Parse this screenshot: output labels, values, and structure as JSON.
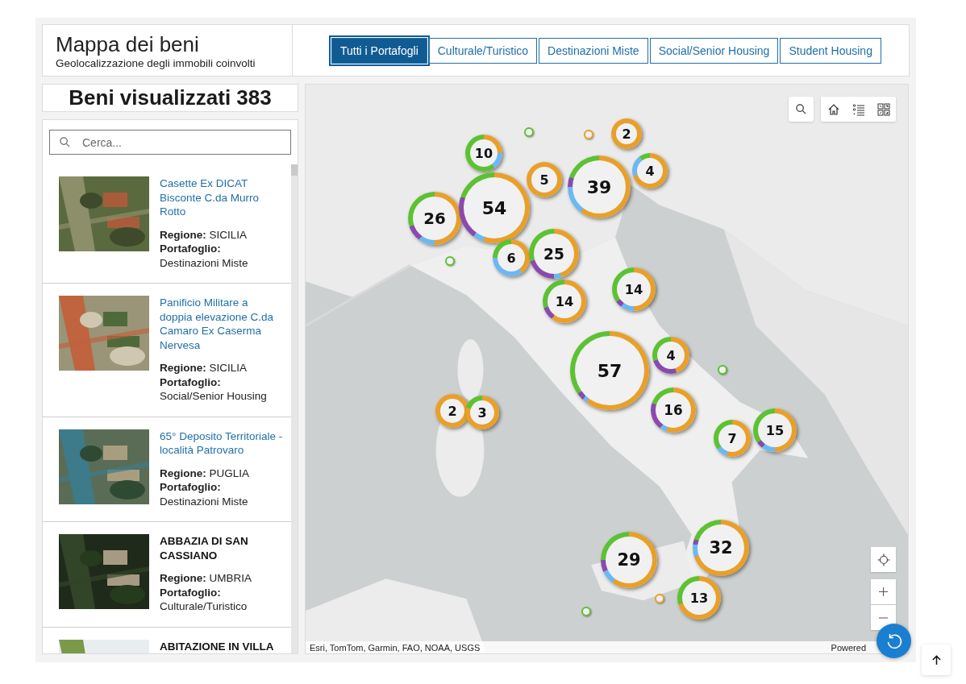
{
  "header": {
    "title": "Mappa dei beni",
    "subtitle": "Geolocalizzazione degli immobili coinvolti"
  },
  "tabs": [
    {
      "label": "Tutti i Portafogli",
      "selected": true
    },
    {
      "label": "Culturale/Turistico",
      "selected": false
    },
    {
      "label": "Destinazioni Miste",
      "selected": false
    },
    {
      "label": "Social/Senior Housing",
      "selected": false
    },
    {
      "label": "Student Housing",
      "selected": false
    }
  ],
  "count_title": "Beni visualizzati 383",
  "search": {
    "placeholder": "Cerca..."
  },
  "assets": [
    {
      "kind": "link",
      "title": "Casette Ex DICAT Bisconte C.da Murro Rotto",
      "region": "**Regione:** SICILIA",
      "portfolio": "**Portafoglio:** Destinazioni Miste"
    },
    {
      "kind": "link",
      "title": "Panificio Militare a doppia elevazione C.da Camaro Ex Caserma Nervesa",
      "region": "**Regione:** SICILIA",
      "portfolio": "**Portafoglio:** Social/Senior Housing"
    },
    {
      "kind": "link",
      "title": "65° Deposito Territoriale - località Patrovaro",
      "region": "**Regione:** PUGLIA",
      "portfolio": "**Portafoglio:** Destinazioni Miste"
    },
    {
      "kind": "plain",
      "title": "ABBAZIA DI SAN CASSIANO",
      "region": "**Regione:** UMBRIA",
      "portfolio": "**Portafoglio:** Culturale/Turistico"
    },
    {
      "kind": "plain",
      "title": "ABITAZIONE IN VILLA"
    }
  ],
  "map": {
    "clusters": [
      "2",
      "10",
      "5",
      "39",
      "4",
      "26",
      "54",
      "6",
      "25",
      "14",
      "14",
      "57",
      "4",
      "2",
      "3",
      "16",
      "7",
      "15",
      "29",
      "32",
      "13"
    ],
    "attribution": "Esri, TomTom, Garmin, FAO, NOAA, USGS",
    "powered": "Powered"
  }
}
